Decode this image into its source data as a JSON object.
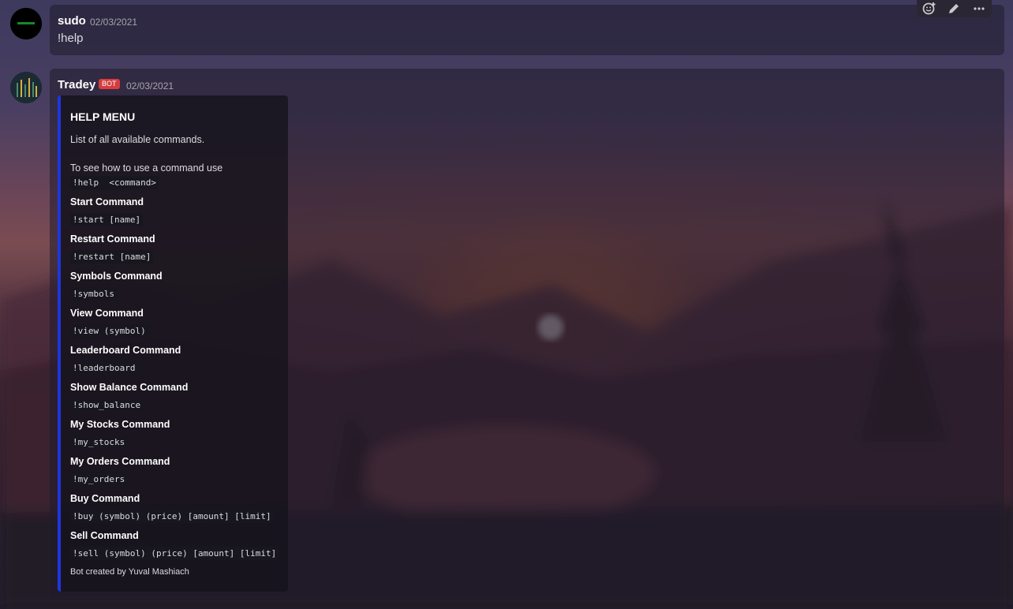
{
  "messages": [
    {
      "author": "sudo",
      "timestamp": "02/03/2021",
      "content": "!help"
    },
    {
      "author": "Tradey",
      "bot_tag": "BOT",
      "timestamp": "02/03/2021",
      "embed": {
        "accent_color": "#1e36e0",
        "title": "HELP MENU",
        "description_line1": "List of all available commands.",
        "description_line2": "To see how to use a command use",
        "help_code": "!help  <command>",
        "fields": [
          {
            "name": "Start Command",
            "value": "!start [name]"
          },
          {
            "name": "Restart Command",
            "value": "!restart [name]"
          },
          {
            "name": "Symbols Command",
            "value": "!symbols"
          },
          {
            "name": "View Command",
            "value": "!view (symbol)"
          },
          {
            "name": "Leaderboard Command",
            "value": "!leaderboard"
          },
          {
            "name": "Show Balance Command",
            "value": "!show_balance"
          },
          {
            "name": "My Stocks Command",
            "value": "!my_stocks"
          },
          {
            "name": "My Orders Command",
            "value": "!my_orders"
          },
          {
            "name": "Buy Command",
            "value": "!buy (symbol) (price) [amount] [limit]"
          },
          {
            "name": "Sell Command",
            "value": "!sell (symbol) (price) [amount] [limit]"
          }
        ],
        "footer": "Bot created by Yuval Mashiach"
      }
    }
  ],
  "toolbar": {
    "icons": [
      "add-reaction-icon",
      "edit-icon",
      "more-icon"
    ]
  },
  "colors": {
    "bot_tag": "#d83c3e",
    "embed_accent": "#1e36e0"
  }
}
